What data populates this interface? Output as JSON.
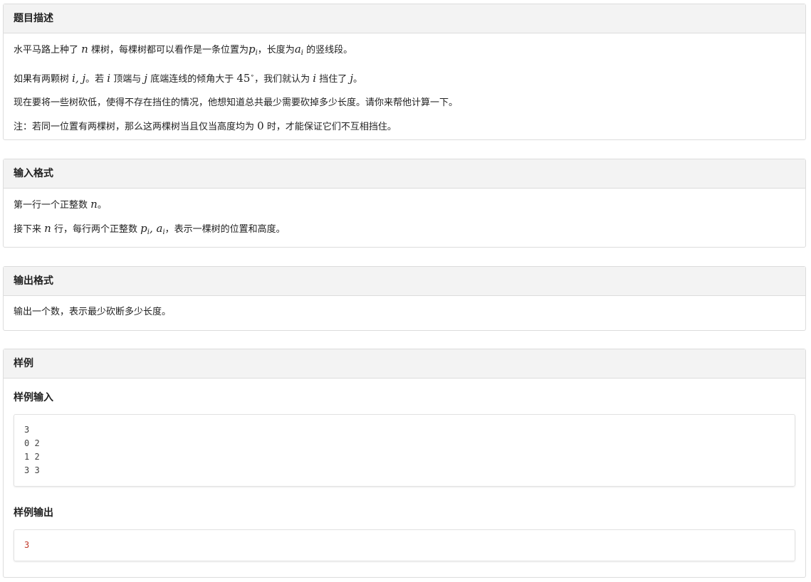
{
  "description": {
    "title": "题目描述",
    "line1": {
      "t1": "水平马路上种了",
      "n": "n",
      "t2": "棵树，每棵树都可以看作是一条位置为",
      "p": "p",
      "p_sub": "i",
      "t3": "，长度为",
      "a": "a",
      "a_sub": "i",
      "t4": "的竖线段。"
    },
    "line2": {
      "t1": "如果有两颗树",
      "ij": "i, j",
      "t2": "。若",
      "i": "i",
      "t3": "顶端与",
      "j": "j",
      "t4": "底端连线的倾角大于",
      "deg": "45",
      "deg_sup": "∘",
      "t5": "，我们就认为",
      "i2": "i",
      "t6": "挡住了",
      "j2": "j",
      "t7": "。"
    },
    "line3": "现在要将一些树砍低，使得不存在挡住的情况，他想知道总共最少需要砍掉多少长度。请你来帮他计算一下。",
    "line4": {
      "t1": "注：若同一位置有两棵树，那么这两棵树当且仅当高度均为",
      "zero": "0",
      "t2": "时，才能保证它们不互相挡住。"
    }
  },
  "input_format": {
    "title": "输入格式",
    "line1": {
      "t1": "第一行一个正整数",
      "n": "n",
      "t2": "。"
    },
    "line2": {
      "t1": "接下来",
      "n": "n",
      "t2": "行，每行两个正整数",
      "p": "p",
      "p_sub": "i",
      "comma": ", ",
      "a": "a",
      "a_sub": "i",
      "t3": "，表示一棵树的位置和高度。"
    }
  },
  "output_format": {
    "title": "输出格式",
    "line1": "输出一个数，表示最少砍断多少长度。"
  },
  "sample": {
    "title": "样例",
    "input_title": "样例输入",
    "input": "3\n0 2\n1 2\n3 3",
    "output_title": "样例输出",
    "output": "3"
  }
}
